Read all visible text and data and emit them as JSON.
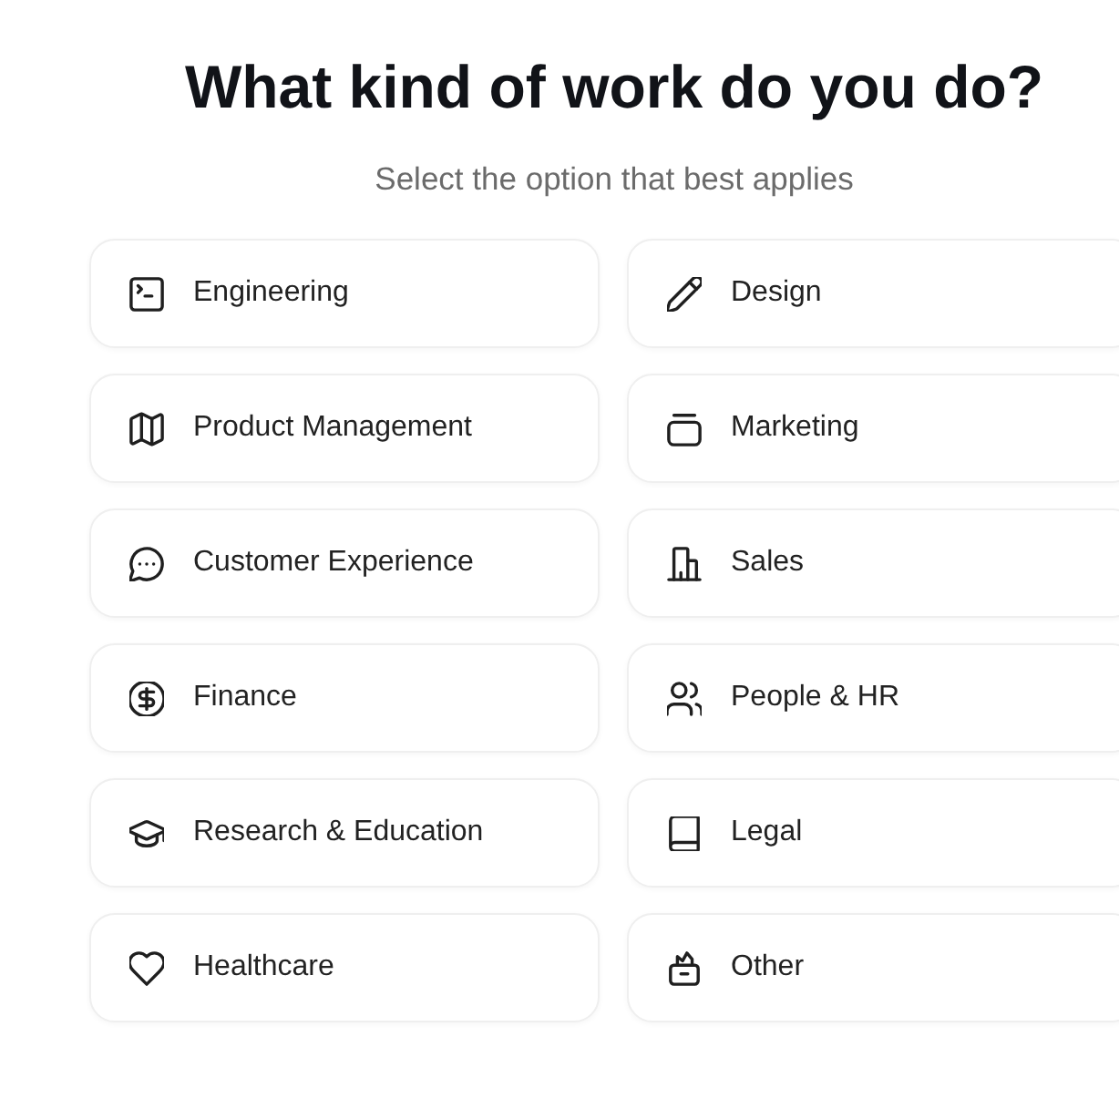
{
  "title": "What kind of work do you do?",
  "subtitle": "Select the option that best applies",
  "options": [
    {
      "label": "Engineering",
      "selected": false
    },
    {
      "label": "Design",
      "selected": false
    },
    {
      "label": "Product Management",
      "selected": false
    },
    {
      "label": "Marketing",
      "selected": false
    },
    {
      "label": "Customer Experience",
      "selected": false
    },
    {
      "label": "Sales",
      "selected": false
    },
    {
      "label": "Finance",
      "selected": false
    },
    {
      "label": "People & HR",
      "selected": false
    },
    {
      "label": "Research & Education",
      "selected": false
    },
    {
      "label": "Legal",
      "selected": false
    },
    {
      "label": "Healthcare",
      "selected": false
    },
    {
      "label": "Other",
      "selected": false
    }
  ]
}
